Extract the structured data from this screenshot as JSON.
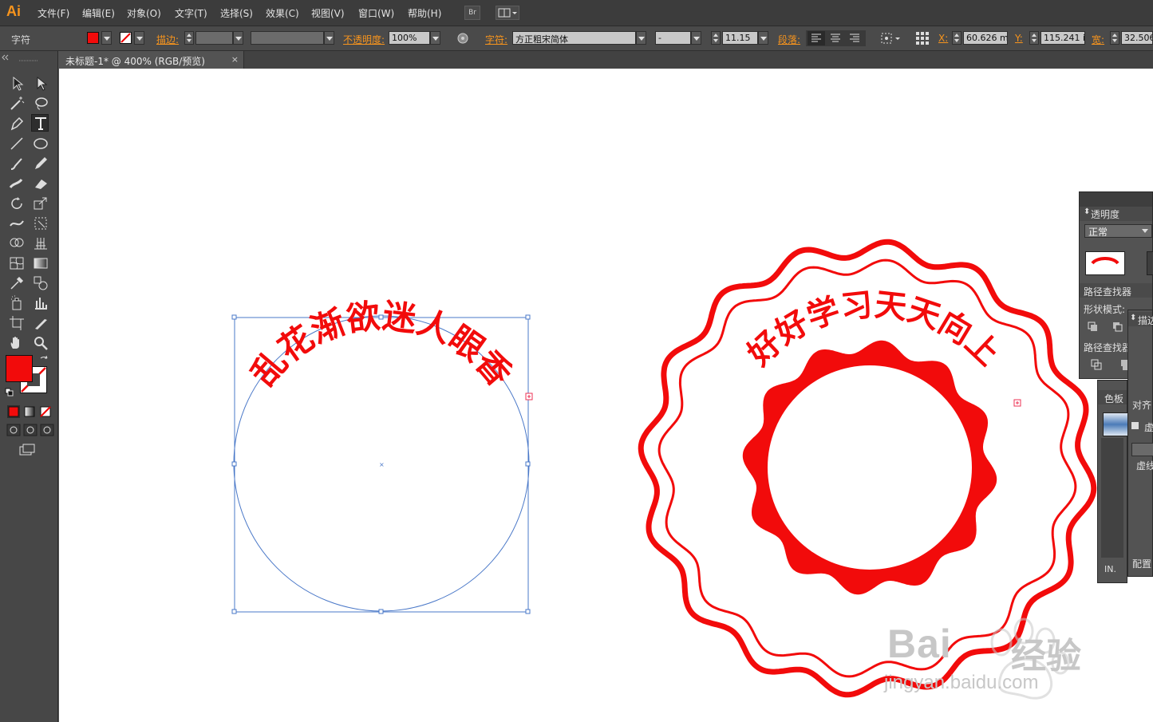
{
  "app": {
    "logo": "Ai"
  },
  "menu": [
    "文件(F)",
    "编辑(E)",
    "对象(O)",
    "文字(T)",
    "选择(S)",
    "效果(C)",
    "视图(V)",
    "窗口(W)",
    "帮助(H)"
  ],
  "menu_buttons": {
    "bridge": "Br"
  },
  "control_bar": {
    "label": "字符",
    "stroke_label": "描边:",
    "opacity_label": "不透明度:",
    "opacity_value": "100%",
    "char_label": "字符:",
    "font_family": "方正粗宋简体",
    "font_style": "-",
    "font_size": "11.15",
    "paragraph_label": "段落:",
    "x_label": "X:",
    "x_value": "60.626 mi",
    "y_label": "Y:",
    "y_value": "115.241 i",
    "w_label": "宽:",
    "w_value": "32.506"
  },
  "document": {
    "tab_title": "未标题-1* @ 400% (RGB/预览)",
    "close": "×"
  },
  "artwork": {
    "left_arc_text": "乱花渐欲迷人眼香",
    "right_arc_text": "好好学习天天向上",
    "stamp_color": "#f20b0b",
    "path_color": "#4a78c8"
  },
  "panels": {
    "transparency": {
      "title": "透明度",
      "blend_mode": "正常"
    },
    "pathfinder": {
      "title": "路径查找器",
      "shape_modes": "形状模式:",
      "pathfinders": "路径查找器"
    },
    "swatches": {
      "title": "色板",
      "menu": "IN."
    },
    "stroke": {
      "title": "描边",
      "align": "对齐",
      "dashed": "虚",
      "dash_label": "虚线",
      "profile": "配置"
    }
  },
  "colors": {
    "fill": "#f20b0b",
    "accent": "#f7941d"
  },
  "watermark": {
    "brand": "Bai",
    "brand_cn": "经验",
    "url": "jingyan.baidu.com"
  }
}
